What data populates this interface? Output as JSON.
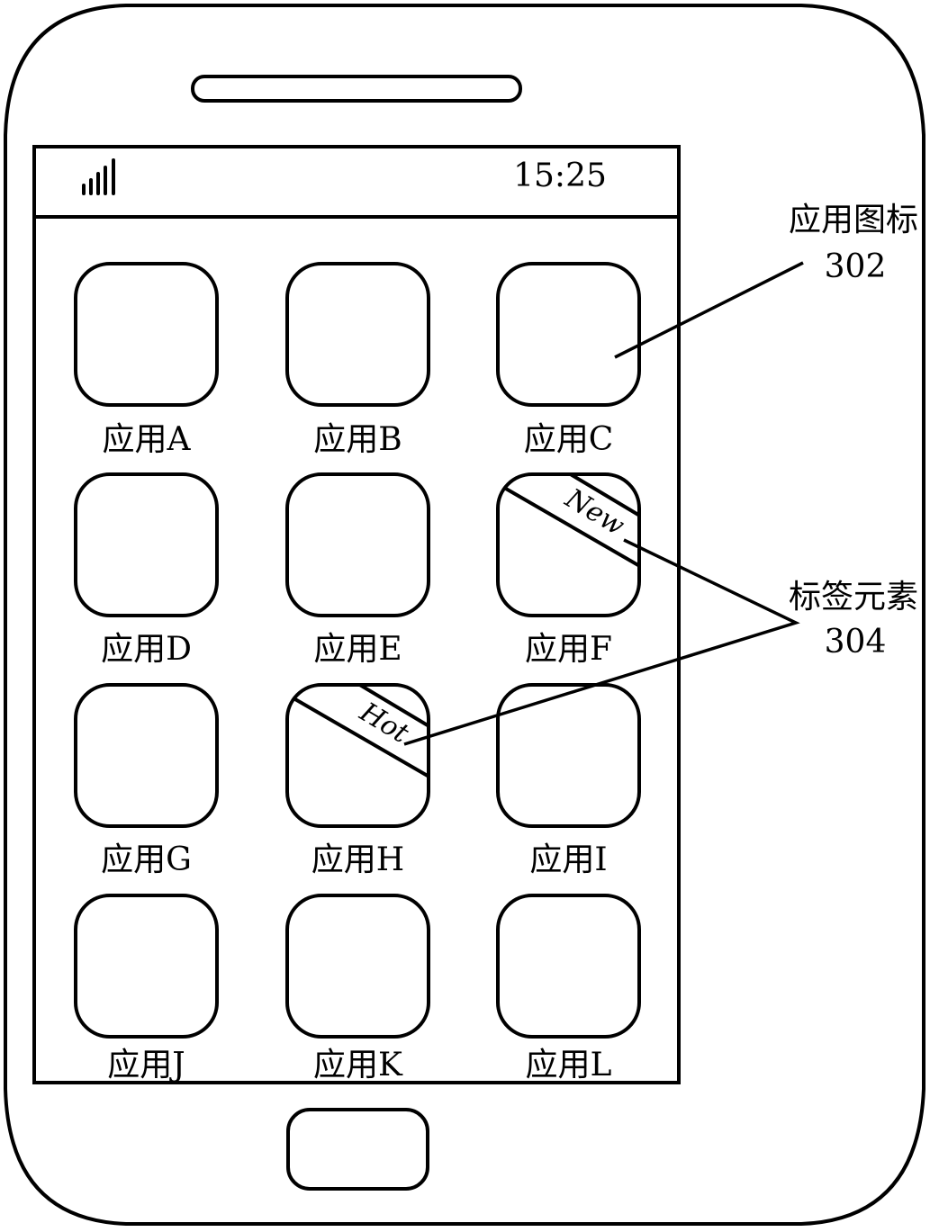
{
  "status_bar": {
    "signal_icon": "signal-bars-icon",
    "time": "15:25"
  },
  "apps": [
    {
      "label": "应用A",
      "tag": null
    },
    {
      "label": "应用B",
      "tag": null
    },
    {
      "label": "应用C",
      "tag": null
    },
    {
      "label": "应用D",
      "tag": null
    },
    {
      "label": "应用E",
      "tag": null
    },
    {
      "label": "应用F",
      "tag": "New"
    },
    {
      "label": "应用G",
      "tag": null
    },
    {
      "label": "应用H",
      "tag": "Hot"
    },
    {
      "label": "应用I",
      "tag": null
    },
    {
      "label": "应用J",
      "tag": null
    },
    {
      "label": "应用K",
      "tag": null
    },
    {
      "label": "应用L",
      "tag": null
    }
  ],
  "callouts": {
    "app_icon": {
      "title": "应用图标",
      "number": "302"
    },
    "tag_element": {
      "title": "标签元素",
      "number": "304"
    }
  },
  "colors": {
    "line": "#000000",
    "background": "#ffffff"
  }
}
